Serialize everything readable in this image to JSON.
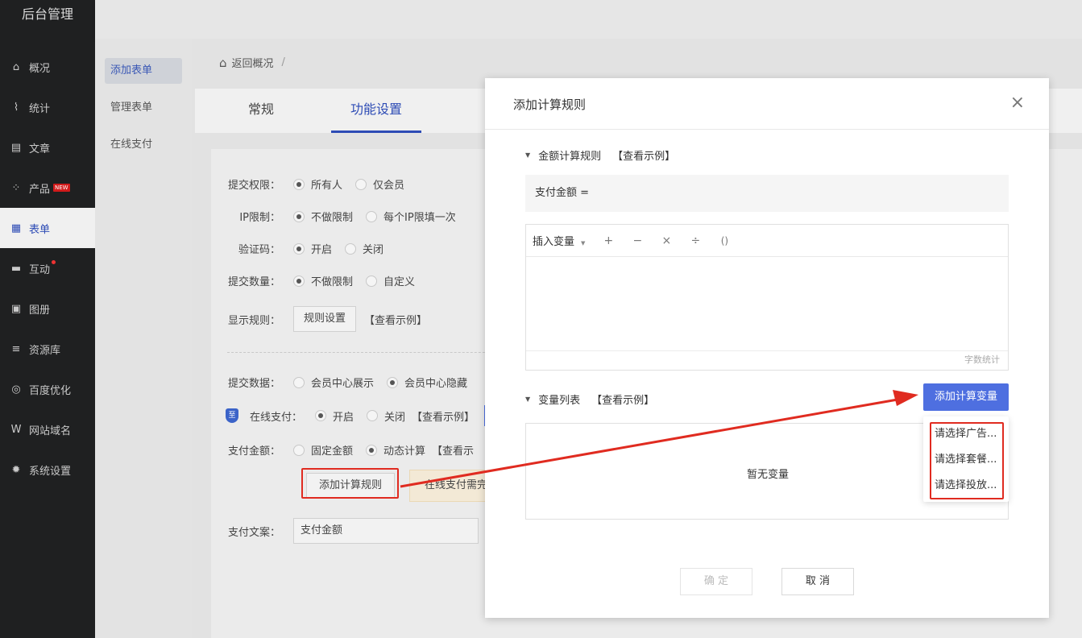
{
  "app": {
    "title": "后台管理"
  },
  "sidebar": {
    "items": [
      {
        "label": "概况",
        "icon": "home-icon",
        "glyph": "⌂"
      },
      {
        "label": "统计",
        "icon": "chart-icon",
        "glyph": "⌇"
      },
      {
        "label": "文章",
        "icon": "article-icon",
        "glyph": "▤"
      },
      {
        "label": "产品",
        "icon": "grid-icon",
        "glyph": "⁘",
        "badge": "NEW"
      },
      {
        "label": "表单",
        "icon": "form-icon",
        "glyph": "▦"
      },
      {
        "label": "互动",
        "icon": "chat-icon",
        "glyph": "▬"
      },
      {
        "label": "图册",
        "icon": "album-icon",
        "glyph": "▣"
      },
      {
        "label": "资源库",
        "icon": "database-icon",
        "glyph": "≡"
      },
      {
        "label": "百度优化",
        "icon": "seo-icon",
        "glyph": "◎"
      },
      {
        "label": "网站域名",
        "icon": "domain-icon",
        "glyph": "W"
      },
      {
        "label": "系统设置",
        "icon": "gear-icon",
        "glyph": "✹"
      }
    ]
  },
  "submenu": {
    "items": [
      "添加表单",
      "管理表单",
      "在线支付"
    ]
  },
  "breadcrumb": {
    "back": "返回概况",
    "sep": "/"
  },
  "tabs": [
    "常规",
    "功能设置"
  ],
  "form": {
    "submit_perm": {
      "label": "提交权限：",
      "opt1": "所有人",
      "opt2": "仅会员"
    },
    "ip_limit": {
      "label": "IP限制：",
      "opt1": "不做限制",
      "opt2": "每个IP限填一次"
    },
    "captcha": {
      "label": "验证码：",
      "opt1": "开启",
      "opt2": "关闭"
    },
    "submit_count": {
      "label": "提交数量：",
      "opt1": "不做限制",
      "opt2": "自定义"
    },
    "display_rule": {
      "label": "显示规则：",
      "button": "规则设置",
      "example": "【查看示例】"
    },
    "submit_data": {
      "label": "提交数据：",
      "opt1": "会员中心展示",
      "opt2": "会员中心隐藏"
    },
    "online_pay": {
      "label": "在线支付：",
      "opt1": "开启",
      "opt2": "关闭",
      "example": "【查看示例】"
    },
    "pay_amount": {
      "label": "支付金额：",
      "opt1": "固定金额",
      "opt2": "动态计算",
      "example": "【查看示"
    },
    "add_rule_button": "添加计算规则",
    "tip": "在线支付需完成",
    "pay_copy": {
      "label": "支付文案：",
      "value": "支付金额"
    }
  },
  "modal": {
    "title": "添加计算规则",
    "close": "×",
    "amount_section": {
      "title": "金额计算规则",
      "example": "【查看示例】"
    },
    "formula": "支付金额 =",
    "insert_var": "插入变量",
    "ops": [
      "+",
      "−",
      "×",
      "÷",
      "()"
    ],
    "word_count": "字数统计",
    "var_section": {
      "title": "变量列表",
      "example": "【查看示例】"
    },
    "add_var_button": "添加计算变量",
    "empty": "暂无变量",
    "dropdown": [
      "请选择广告...",
      "请选择套餐...",
      "请选择投放..."
    ],
    "confirm": "确 定",
    "cancel": "取 消"
  },
  "colors": {
    "accent": "#4e6fe0",
    "highlight": "#e02b20",
    "sidebar": "#1f2021"
  }
}
